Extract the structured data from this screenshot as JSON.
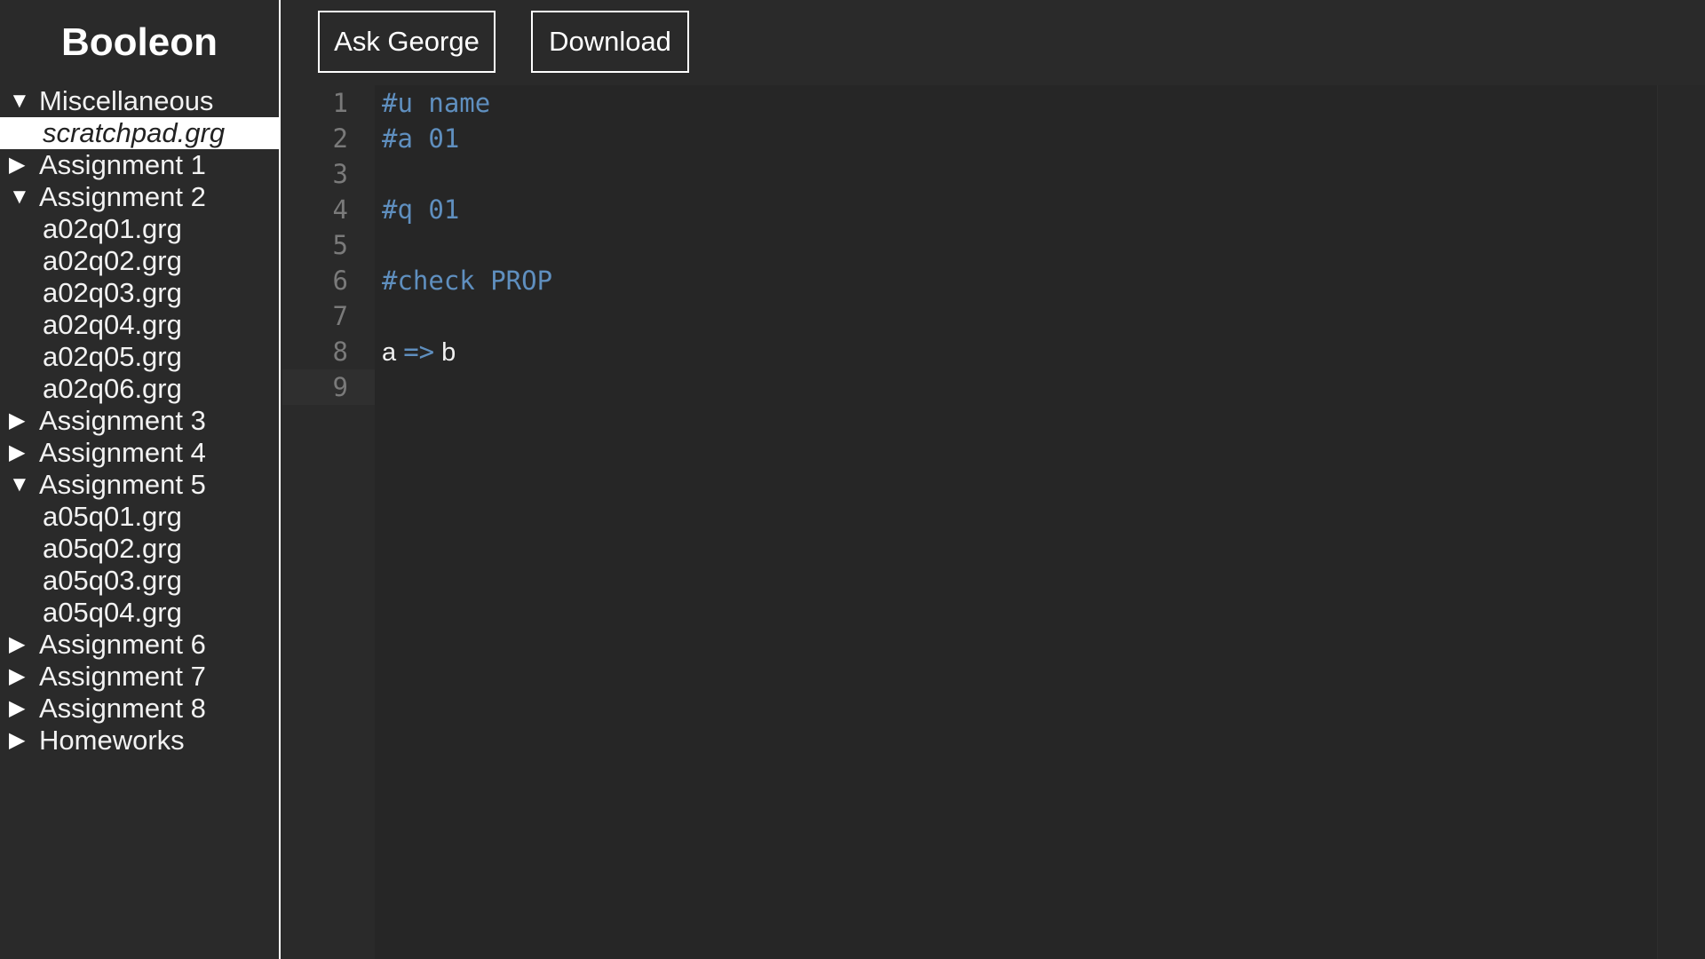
{
  "sidebar": {
    "brand": "Booleon",
    "tree": [
      {
        "type": "folder",
        "label": "Miscellaneous",
        "expanded": true,
        "toggle": "▼"
      },
      {
        "type": "file",
        "label": "scratchpad.grg",
        "selected": true
      },
      {
        "type": "folder",
        "label": "Assignment 1",
        "expanded": false,
        "toggle": "▶"
      },
      {
        "type": "folder",
        "label": "Assignment 2",
        "expanded": true,
        "toggle": "▼"
      },
      {
        "type": "file",
        "label": "a02q01.grg"
      },
      {
        "type": "file",
        "label": "a02q02.grg"
      },
      {
        "type": "file",
        "label": "a02q03.grg"
      },
      {
        "type": "file",
        "label": "a02q04.grg"
      },
      {
        "type": "file",
        "label": "a02q05.grg"
      },
      {
        "type": "file",
        "label": "a02q06.grg"
      },
      {
        "type": "folder",
        "label": "Assignment 3",
        "expanded": false,
        "toggle": "▶"
      },
      {
        "type": "folder",
        "label": "Assignment 4",
        "expanded": false,
        "toggle": "▶"
      },
      {
        "type": "folder",
        "label": "Assignment 5",
        "expanded": true,
        "toggle": "▼"
      },
      {
        "type": "file",
        "label": "a05q01.grg"
      },
      {
        "type": "file",
        "label": "a05q02.grg"
      },
      {
        "type": "file",
        "label": "a05q03.grg"
      },
      {
        "type": "file",
        "label": "a05q04.grg"
      },
      {
        "type": "folder",
        "label": "Assignment 6",
        "expanded": false,
        "toggle": "▶"
      },
      {
        "type": "folder",
        "label": "Assignment 7",
        "expanded": false,
        "toggle": "▶"
      },
      {
        "type": "folder",
        "label": "Assignment 8",
        "expanded": false,
        "toggle": "▶"
      },
      {
        "type": "folder",
        "label": "Homeworks",
        "expanded": false,
        "toggle": "▶"
      }
    ]
  },
  "toolbar": {
    "ask_label": "Ask George",
    "download_label": "Download"
  },
  "editor": {
    "lines": [
      {
        "no": "1",
        "tokens": [
          {
            "t": "#u name",
            "k": "directive"
          }
        ]
      },
      {
        "no": "2",
        "tokens": [
          {
            "t": "#a 01",
            "k": "directive"
          }
        ]
      },
      {
        "no": "3",
        "tokens": []
      },
      {
        "no": "4",
        "tokens": [
          {
            "t": "#q 01",
            "k": "directive"
          }
        ]
      },
      {
        "no": "5",
        "tokens": []
      },
      {
        "no": "6",
        "tokens": [
          {
            "t": "#check PROP",
            "k": "directive"
          }
        ]
      },
      {
        "no": "7",
        "tokens": []
      },
      {
        "no": "8",
        "tokens": [
          {
            "t": "a",
            "k": "ident"
          },
          {
            "t": " ",
            "k": "ident"
          },
          {
            "t": "=>",
            "k": "op"
          },
          {
            "t": " b",
            "k": "ident"
          }
        ]
      },
      {
        "no": "9",
        "tokens": [],
        "active": true
      }
    ]
  },
  "colors": {
    "background": "#2a2a2a",
    "editor_bg": "#262626",
    "keyword": "#5f8fbf",
    "text": "#f0f0f0",
    "line_number": "#7a7a7a"
  }
}
